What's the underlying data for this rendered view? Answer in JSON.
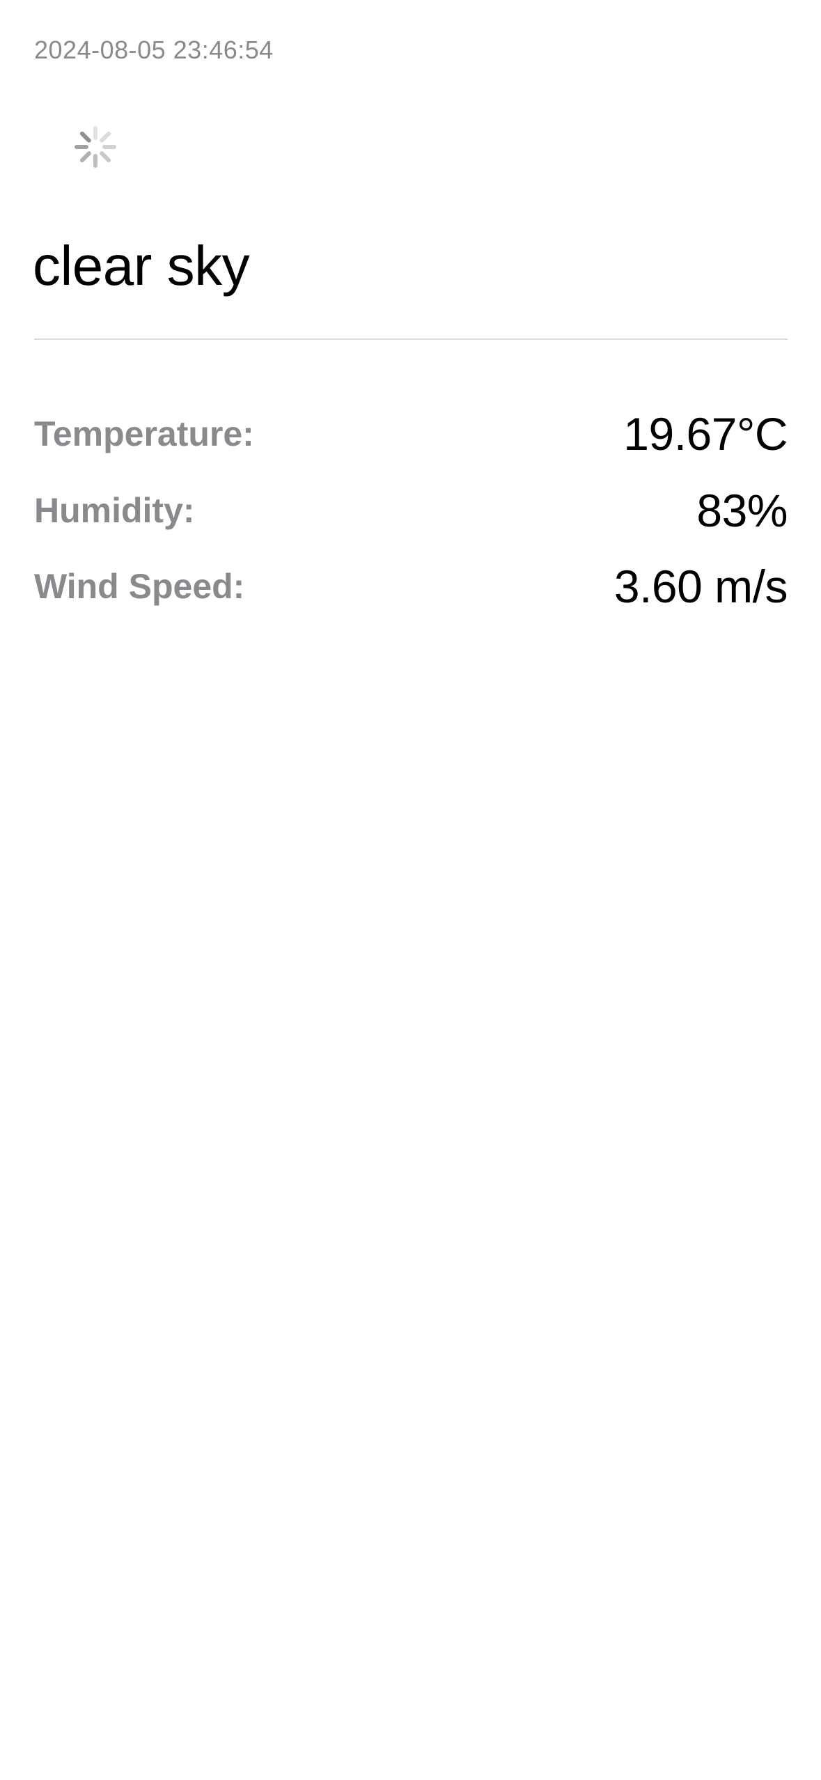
{
  "timestamp": "2024-08-05 23:46:54",
  "icons": {
    "loading": "activity-spinner-icon"
  },
  "weather": {
    "description": "clear sky",
    "details": [
      {
        "label": "Temperature:",
        "value": "19.67°C"
      },
      {
        "label": "Humidity:",
        "value": "83%"
      },
      {
        "label": "Wind Speed:",
        "value": "3.60 m/s"
      }
    ]
  },
  "colors": {
    "background": "#ffffff",
    "primary_text": "#000000",
    "secondary_text": "#8a8a8e",
    "divider": "#dcdcdf"
  }
}
